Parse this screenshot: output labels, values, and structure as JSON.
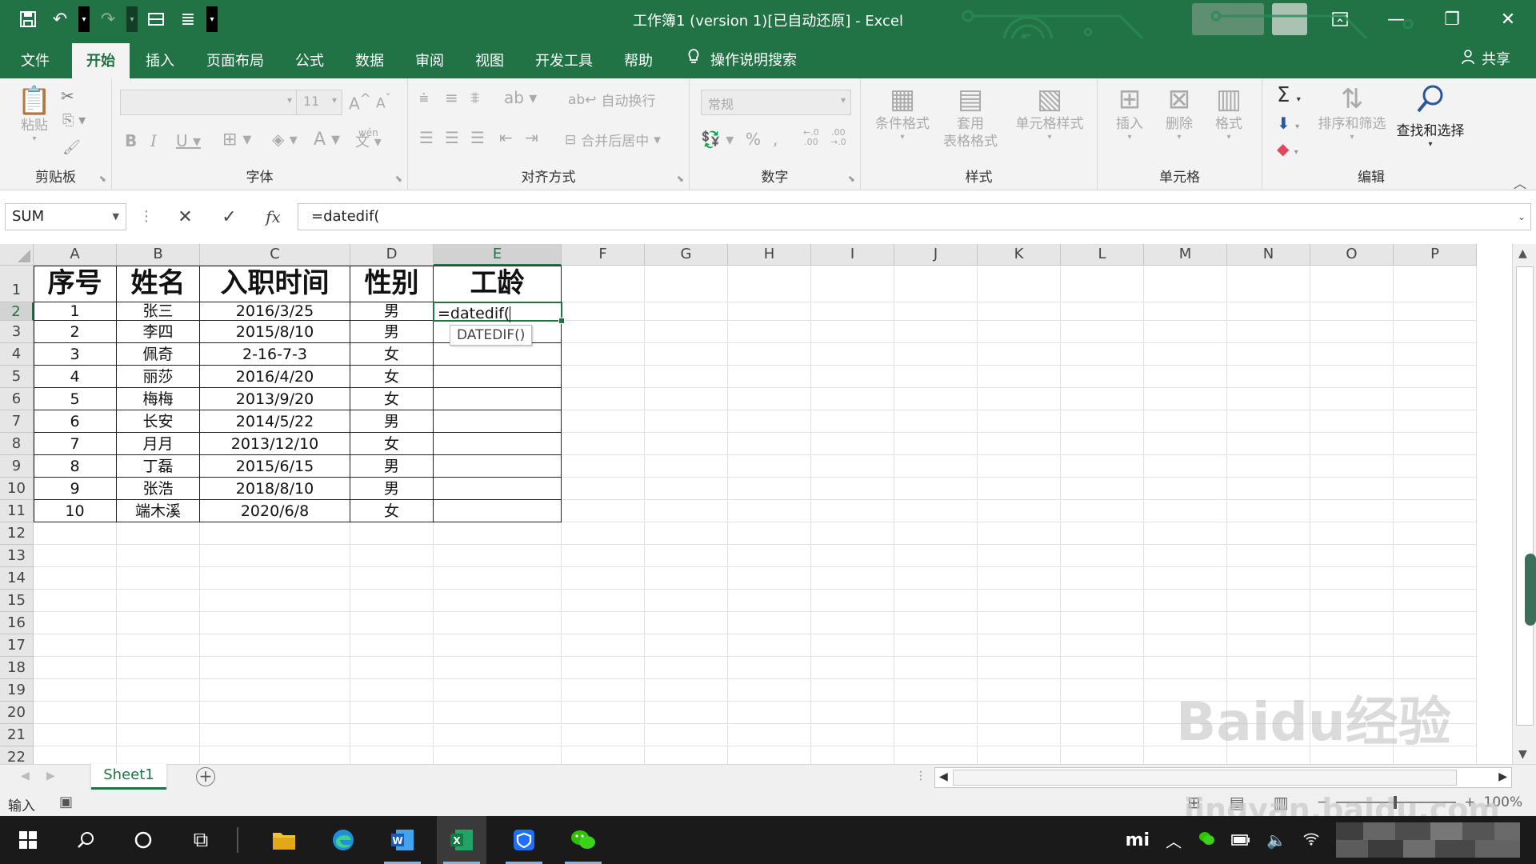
{
  "window": {
    "title": "工作簿1 (version 1)[已自动还原]  -  Excel"
  },
  "menu": {
    "tabs": [
      "文件",
      "开始",
      "插入",
      "页面布局",
      "公式",
      "数据",
      "审阅",
      "视图",
      "开发工具",
      "帮助"
    ],
    "active_tab": "开始",
    "tell_me": "操作说明搜索",
    "share": "共享"
  },
  "ribbon": {
    "clipboard": {
      "label": "剪贴板",
      "paste": "粘贴"
    },
    "font": {
      "label": "字体",
      "size": "11",
      "wen": "wén"
    },
    "alignment": {
      "label": "对齐方式",
      "wrap": "自动换行",
      "merge": "合并后居中"
    },
    "number": {
      "label": "数字",
      "format": "常规"
    },
    "styles": {
      "label": "样式",
      "conditional": "条件格式",
      "table_format_1": "套用",
      "table_format_2": "表格格式",
      "cell_styles": "单元格样式"
    },
    "cells": {
      "label": "单元格",
      "insert": "插入",
      "delete": "删除",
      "format": "格式"
    },
    "editing": {
      "label": "编辑",
      "sort_filter": "排序和筛选",
      "find_select": "查找和选择"
    }
  },
  "formula_bar": {
    "name_box": "SUM",
    "formula": "=datedif("
  },
  "grid": {
    "columns": [
      "A",
      "B",
      "C",
      "D",
      "E",
      "F",
      "G",
      "H",
      "I",
      "J",
      "K",
      "L",
      "M",
      "N",
      "O",
      "P"
    ],
    "rows": [
      "1",
      "2",
      "3",
      "4",
      "5",
      "6",
      "7",
      "8",
      "9",
      "10",
      "11",
      "12",
      "13",
      "14",
      "15",
      "16",
      "17",
      "18",
      "19",
      "20",
      "21",
      "22"
    ],
    "selected_column": "E",
    "selected_row": "2"
  },
  "table": {
    "headers": [
      "序号",
      "姓名",
      "入职时间",
      "性别",
      "工龄"
    ],
    "rows": [
      [
        "1",
        "张三",
        "2016/3/25",
        "男"
      ],
      [
        "2",
        "李四",
        "2015/8/10",
        "男"
      ],
      [
        "3",
        "佩奇",
        "2-16-7-3",
        "女"
      ],
      [
        "4",
        "丽莎",
        "2016/4/20",
        "女"
      ],
      [
        "5",
        "梅梅",
        "2013/9/20",
        "女"
      ],
      [
        "6",
        "长安",
        "2014/5/22",
        "男"
      ],
      [
        "7",
        "月月",
        "2013/12/10",
        "女"
      ],
      [
        "8",
        "丁磊",
        "2015/6/15",
        "男"
      ],
      [
        "9",
        "张浩",
        "2018/8/10",
        "男"
      ],
      [
        "10",
        "端木溪",
        "2020/6/8",
        "女"
      ]
    ]
  },
  "editing_cell": {
    "text": "=datedif(",
    "tooltip": "DATEDIF()"
  },
  "sheet_tabs": {
    "active": "Sheet1",
    "add": "+"
  },
  "status_bar": {
    "mode": "输入",
    "zoom": "100%",
    "minus": "−",
    "plus": "+"
  },
  "taskbar": {
    "excel_label": "X",
    "word_label": "W",
    "tray_brand": "mi"
  },
  "watermark": {
    "line1": "Baidu经验",
    "line2": "jingyan.baidu.com"
  },
  "colors": {
    "excel_green": "#217346",
    "taskbar": "#1a1a1a"
  }
}
